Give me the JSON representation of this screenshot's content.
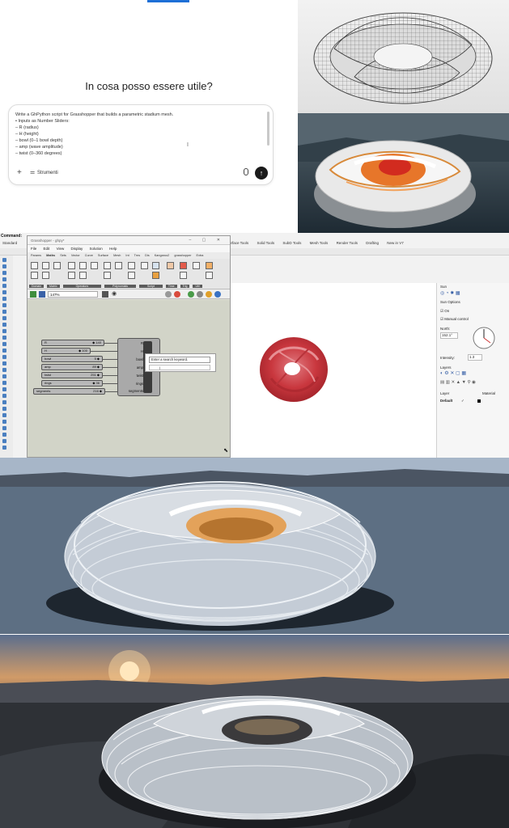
{
  "chat": {
    "heading": "In cosa posso essere utile?",
    "prompt_lines": [
      "Write a GhPython script for Grasshopper that builds a parametric stadium mesh.",
      "• Inputs as Number Sliders:",
      "  – R (radius)",
      "  – H (height)",
      "  – bowl (0–1 bowl depth)",
      "  – amp (wave amplitude)",
      "  – twist (0–360 degrees)"
    ],
    "tools_label": "Strumenti",
    "plus_icon": "+",
    "send_icon": "↑"
  },
  "rhino": {
    "command_label": "Command:",
    "standard_tab": "Standard",
    "tabs": [
      "urface Tools",
      "Solid Tools",
      "SubD Tools",
      "Mesh Tools",
      "Render Tools",
      "Drafting",
      "New in V7"
    ]
  },
  "grasshopper": {
    "title": "Grasshopper - ghpy*",
    "window_controls": "–  ▢  ✕",
    "menu": [
      "File",
      "Edit",
      "View",
      "Display",
      "Solution",
      "Help"
    ],
    "tabs": [
      "Params",
      "Maths",
      "Sets",
      "Vector",
      "Curve",
      "Surface",
      "Mesh",
      "Int",
      "Trns",
      "Dis",
      "Kangaroo2",
      "grasshopper",
      "Extra"
    ],
    "ribbon_groups": [
      "Domain",
      "Matrix",
      "Operators",
      "Polynomials",
      "Script",
      "Time",
      "Trig",
      "Util"
    ],
    "zoom": "147%",
    "sliders": [
      {
        "name": "R",
        "value": "◆ 140"
      },
      {
        "name": "H",
        "value": "◆ 100"
      },
      {
        "name": "bowl",
        "value": "5 ◆"
      },
      {
        "name": "amp",
        "value": "89 ◆"
      },
      {
        "name": "twist",
        "value": "251 ◆"
      },
      {
        "name": "rings",
        "value": "◆ 36"
      },
      {
        "name": "segments",
        "value": "216 ◆"
      }
    ],
    "component_ports": [
      "R",
      "H",
      "bowl",
      "amp",
      "twist",
      "rings",
      "segments"
    ],
    "search_hint": "Enter a search keyword.",
    "search_value": "|"
  },
  "sun_panel": {
    "header": "Sun",
    "options_label": "Sun Options",
    "on_label": "On",
    "manual_label": "Manual control",
    "north_label": "North:",
    "north_value": "152.1°",
    "intensity_label": "Intensity:",
    "intensity_value": "1.3",
    "layers_header": "Layers",
    "layer_col": "Layer",
    "material_col": "Material",
    "default_layer": "Default"
  },
  "colors": {
    "accent": "#1d6fd6",
    "send_button": "#1a1a1a",
    "mesh_red": "#c9373e",
    "gh_canvas": "#d2d4c8"
  },
  "icons": {
    "plus": "plus-icon",
    "tools": "tools-icon",
    "mic": "microphone-icon",
    "send": "send-arrow-icon"
  }
}
